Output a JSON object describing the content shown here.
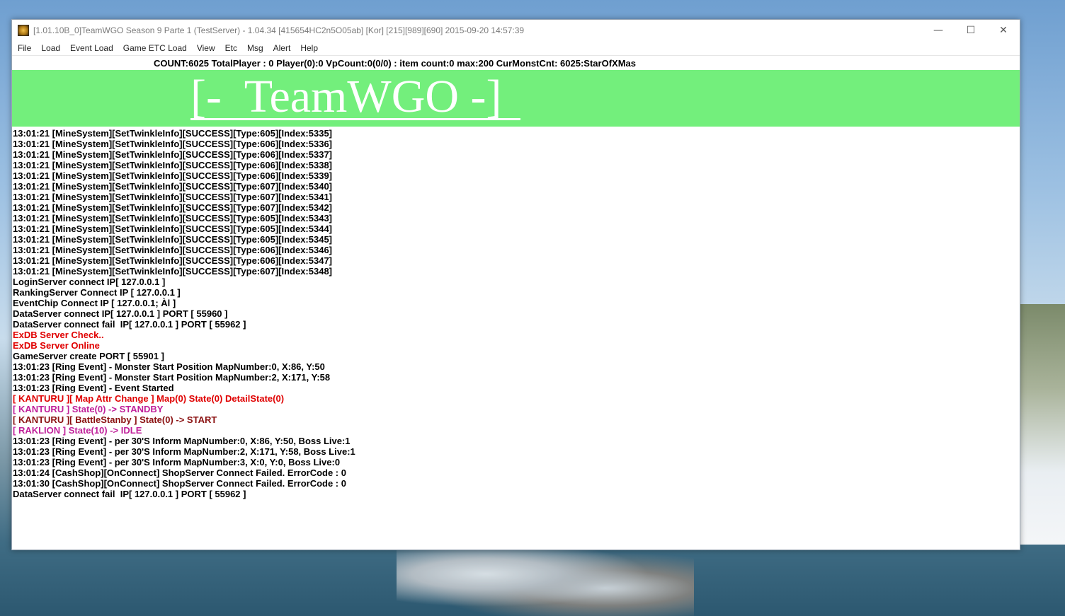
{
  "window": {
    "title": "[1.01.10B_0]TeamWGO Season 9 Parte 1 (TestServer) - 1.04.34 [415654HC2n5O05ab] [Kor] [215][989][690] 2015-09-20 14:57:39",
    "minimize": "—",
    "maximize": "☐",
    "close": "✕"
  },
  "menu": [
    "File",
    "Load",
    "Event Load",
    "Game ETC Load",
    "View",
    "Etc",
    "Msg",
    "Alert",
    "Help"
  ],
  "status": "COUNT:6025  TotalPlayer : 0  Player(0):0 VpCount:0(0/0) : item count:0 max:200 CurMonstCnt: 6025:StarOfXMas",
  "banner": "[-  TeamWGO -]",
  "colors": {
    "normal": "#000000",
    "red": "#e00000",
    "magenta": "#c0209a",
    "darkred": "#8a1010",
    "banner_bg": "#73ef7c"
  },
  "log": [
    {
      "text": "13:01:21 [MineSystem][SetTwinkleInfo][SUCCESS][Type:605][Index:5335]",
      "color": "#000000"
    },
    {
      "text": "13:01:21 [MineSystem][SetTwinkleInfo][SUCCESS][Type:606][Index:5336]",
      "color": "#000000"
    },
    {
      "text": "13:01:21 [MineSystem][SetTwinkleInfo][SUCCESS][Type:606][Index:5337]",
      "color": "#000000"
    },
    {
      "text": "13:01:21 [MineSystem][SetTwinkleInfo][SUCCESS][Type:606][Index:5338]",
      "color": "#000000"
    },
    {
      "text": "13:01:21 [MineSystem][SetTwinkleInfo][SUCCESS][Type:606][Index:5339]",
      "color": "#000000"
    },
    {
      "text": "13:01:21 [MineSystem][SetTwinkleInfo][SUCCESS][Type:607][Index:5340]",
      "color": "#000000"
    },
    {
      "text": "13:01:21 [MineSystem][SetTwinkleInfo][SUCCESS][Type:607][Index:5341]",
      "color": "#000000"
    },
    {
      "text": "13:01:21 [MineSystem][SetTwinkleInfo][SUCCESS][Type:607][Index:5342]",
      "color": "#000000"
    },
    {
      "text": "13:01:21 [MineSystem][SetTwinkleInfo][SUCCESS][Type:605][Index:5343]",
      "color": "#000000"
    },
    {
      "text": "13:01:21 [MineSystem][SetTwinkleInfo][SUCCESS][Type:605][Index:5344]",
      "color": "#000000"
    },
    {
      "text": "13:01:21 [MineSystem][SetTwinkleInfo][SUCCESS][Type:605][Index:5345]",
      "color": "#000000"
    },
    {
      "text": "13:01:21 [MineSystem][SetTwinkleInfo][SUCCESS][Type:606][Index:5346]",
      "color": "#000000"
    },
    {
      "text": "13:01:21 [MineSystem][SetTwinkleInfo][SUCCESS][Type:606][Index:5347]",
      "color": "#000000"
    },
    {
      "text": "13:01:21 [MineSystem][SetTwinkleInfo][SUCCESS][Type:607][Index:5348]",
      "color": "#000000"
    },
    {
      "text": "LoginServer connect IP[ 127.0.0.1 ]",
      "color": "#000000"
    },
    {
      "text": "RankingServer Connect IP [ 127.0.0.1 ]",
      "color": "#000000"
    },
    {
      "text": "EventChip Connect IP [ 127.0.0.1; Àl ]",
      "color": "#000000"
    },
    {
      "text": "DataServer connect IP[ 127.0.0.1 ] PORT [ 55960 ]",
      "color": "#000000"
    },
    {
      "text": "DataServer connect fail  IP[ 127.0.0.1 ] PORT [ 55962 ]",
      "color": "#000000"
    },
    {
      "text": "ExDB Server Check..",
      "color": "#e00000"
    },
    {
      "text": "ExDB Server Online",
      "color": "#e00000"
    },
    {
      "text": "GameServer create PORT [ 55901 ]",
      "color": "#000000"
    },
    {
      "text": "13:01:23 [Ring Event] - Monster Start Position MapNumber:0, X:86, Y:50",
      "color": "#000000"
    },
    {
      "text": "13:01:23 [Ring Event] - Monster Start Position MapNumber:2, X:171, Y:58",
      "color": "#000000"
    },
    {
      "text": "13:01:23 [Ring Event] - Event Started",
      "color": "#000000"
    },
    {
      "text": "[ KANTURU ][ Map Attr Change ] Map(0) State(0) DetailState(0)",
      "color": "#e00000"
    },
    {
      "text": "[ KANTURU ] State(0) -> STANDBY",
      "color": "#c0209a"
    },
    {
      "text": "[ KANTURU ][ BattleStanby ] State(0) -> START",
      "color": "#8a1010"
    },
    {
      "text": "[ RAKLION ] State(10) -> IDLE",
      "color": "#c0209a"
    },
    {
      "text": "13:01:23 [Ring Event] - per 30'S Inform MapNumber:0, X:86, Y:50, Boss Live:1",
      "color": "#000000"
    },
    {
      "text": "13:01:23 [Ring Event] - per 30'S Inform MapNumber:2, X:171, Y:58, Boss Live:1",
      "color": "#000000"
    },
    {
      "text": "13:01:23 [Ring Event] - per 30'S Inform MapNumber:3, X:0, Y:0, Boss Live:0",
      "color": "#000000"
    },
    {
      "text": "13:01:24 [CashShop][OnConnect] ShopServer Connect Failed. ErrorCode : 0",
      "color": "#000000"
    },
    {
      "text": "13:01:30 [CashShop][OnConnect] ShopServer Connect Failed. ErrorCode : 0",
      "color": "#000000"
    },
    {
      "text": "DataServer connect fail  IP[ 127.0.0.1 ] PORT [ 55962 ]",
      "color": "#000000"
    }
  ]
}
